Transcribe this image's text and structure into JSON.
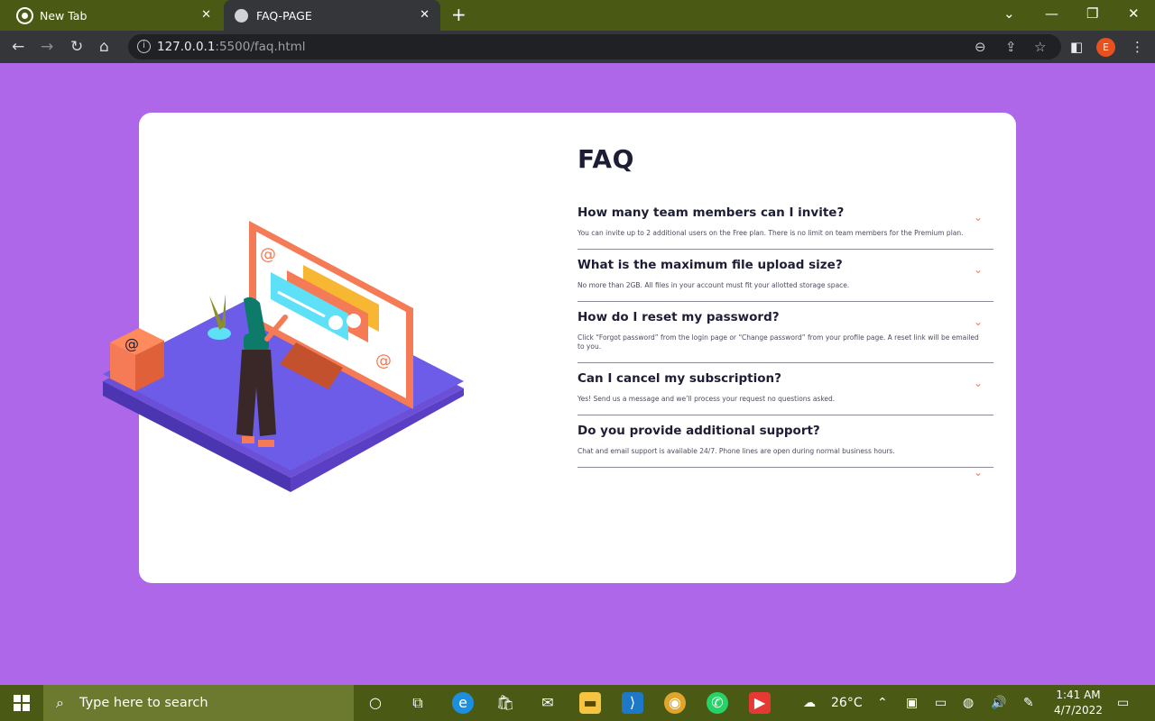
{
  "browser": {
    "tabs": [
      {
        "label": "New Tab",
        "icon": "chrome-icon"
      },
      {
        "label": "FAQ-PAGE",
        "icon": "page-icon"
      }
    ],
    "url_host": "127.0.0.1",
    "url_rest": ":5500/faq.html",
    "profile_initial": "E"
  },
  "faq": {
    "title": "FAQ",
    "items": [
      {
        "question": "How many team members can I invite?",
        "answer": "You can invite up to 2 additional users on the Free plan. There is no limit on team members for the Premium plan."
      },
      {
        "question": "What is the maximum file upload size?",
        "answer": "No more than 2GB. All files in your account must fit your allotted storage space."
      },
      {
        "question": "How do I reset my password?",
        "answer": "Click “Forgot password” from the login page or “Change password” from your profile page. A reset link will be emailed to you."
      },
      {
        "question": "Can I cancel my subscription?",
        "answer": "Yes! Send us a message and we’ll process your request no questions asked."
      },
      {
        "question": "Do you provide additional support?",
        "answer": "Chat and email support is available 24/7. Phone lines are open during normal business hours."
      }
    ]
  },
  "taskbar": {
    "search_placeholder": "Type here to search",
    "weather": "26°C",
    "time": "1:41 AM",
    "date": "4/7/2022"
  },
  "colors": {
    "page_bg": "#af67e9",
    "accent": "#f47b56",
    "heading": "#1d1e35"
  }
}
